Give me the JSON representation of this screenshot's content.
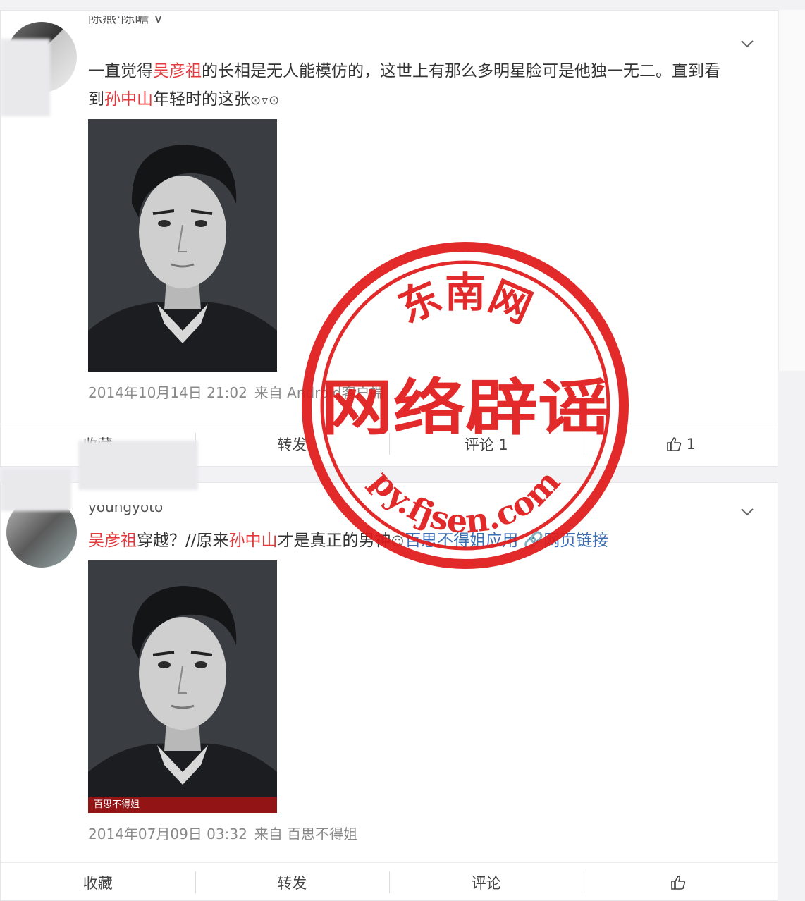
{
  "posts": [
    {
      "username": "陈燕·陈瞻 V",
      "text_parts": [
        "一直觉得",
        "吴彦祖",
        "的长相是无人能模仿的，这世上有那么多明星脸可是他独一无二。直到看到",
        "孙中山",
        "年轻时的这张"
      ],
      "emoticon": "⊙▿⊙",
      "date": "2014年10月14日 21:02",
      "source": "来自 Android客户端",
      "actions": {
        "favorite": "收藏",
        "repost": "转发",
        "comment": "评论 1",
        "like_count": "1"
      }
    },
    {
      "username": "youngyoto",
      "text_parts": [
        "吴彦祖",
        "穿越？//原来",
        "孙中山",
        "才是真正的男神",
        "百思不得姐应用"
      ],
      "emoticon": "☺",
      "link_label": "网页链接",
      "image_caption": "百思不得姐",
      "date": "2014年07月09日 03:32",
      "source": "来自 百思不得姐",
      "actions": {
        "favorite": "收藏",
        "repost": "转发",
        "comment": "评论",
        "like_count": ""
      }
    }
  ],
  "stamp": {
    "top_text": "东南网",
    "center_text": "网络辟谣",
    "bottom_text": "py.fjsen.com",
    "color": "#e01a1a"
  },
  "colors": {
    "highlight": "#e4393c",
    "link": "#3a6fb4",
    "meta": "#888888"
  }
}
